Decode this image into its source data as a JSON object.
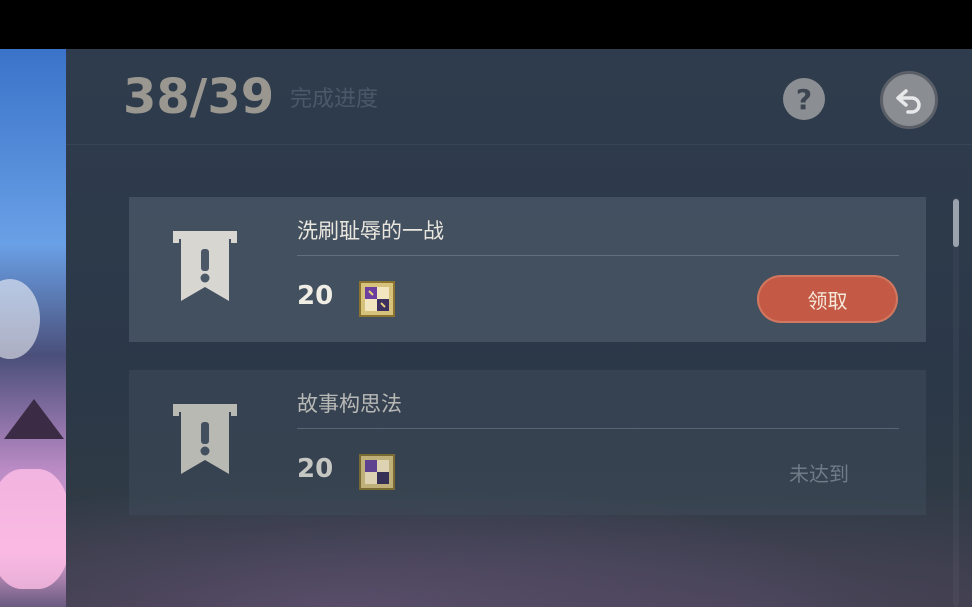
{
  "header": {
    "progress": "38/39",
    "progress_label": "完成进度",
    "help_label": "?"
  },
  "achievements": [
    {
      "title": "洗刷耻辱的一战",
      "reward_amount": "20",
      "action_label": "领取",
      "status": "claimable"
    },
    {
      "title": "故事构思法",
      "reward_amount": "20",
      "action_label": "未达到",
      "status": "not_reached"
    }
  ],
  "icons": {
    "banner": "achievement-banner-icon",
    "reward": "primogem-reward-icon",
    "help": "question-icon",
    "back": "back-arrow-icon"
  },
  "colors": {
    "claim_button": "#c45a45",
    "panel": "#2f3c4d"
  }
}
